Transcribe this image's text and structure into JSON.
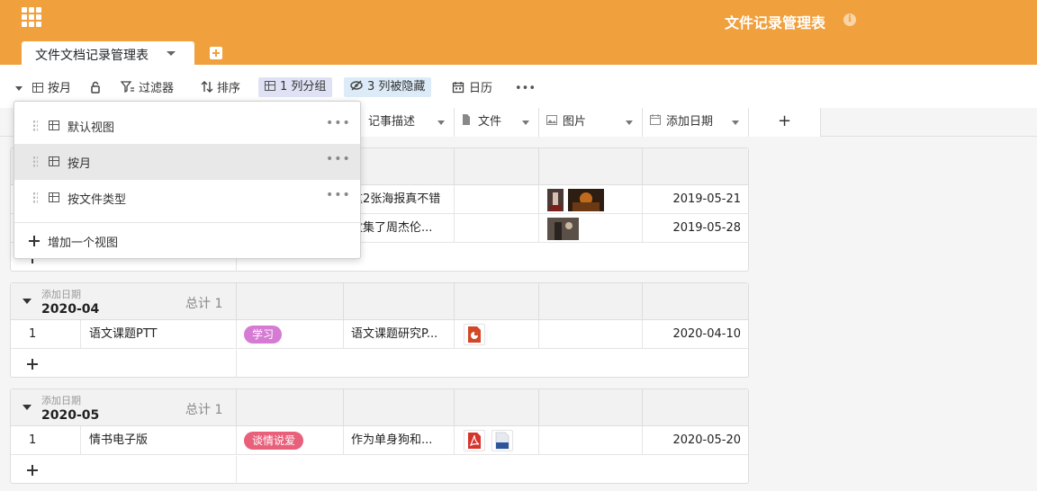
{
  "header": {
    "title": "文件记录管理表",
    "tab_label": "文件文档记录管理表"
  },
  "toolbar": {
    "view_label": "按月",
    "filter_label": "过滤器",
    "sort_label": "排序",
    "group_label": "1 列分组",
    "hidden_label": "3 列被隐藏",
    "calendar_label": "日历",
    "more_label": "•••"
  },
  "columns": [
    {
      "label": "记事描述",
      "icon": "paragraph-icon"
    },
    {
      "label": "文件",
      "icon": "file-icon"
    },
    {
      "label": "图片",
      "icon": "image-icon"
    },
    {
      "label": "添加日期",
      "icon": "calendar-icon"
    }
  ],
  "add_column_label": "+",
  "groups": [
    {
      "field": "",
      "value": "",
      "count": "",
      "rows": [
        {
          "desc": "这2张海报真不错",
          "date": "2019-05-21"
        },
        {
          "desc": "收集了周杰伦...",
          "date": "2019-05-28"
        }
      ]
    },
    {
      "field": "添加日期",
      "value": "2020-04",
      "count": "总计 1",
      "rows": [
        {
          "index": "1",
          "name": "语文课题PTT",
          "tag": "学习",
          "tag_color": "#d67bd4",
          "desc": "语文课题研究P...",
          "date": "2020-04-10"
        }
      ]
    },
    {
      "field": "添加日期",
      "value": "2020-05",
      "count": "总计 1",
      "rows": [
        {
          "index": "1",
          "name": "情书电子版",
          "tag": "谈情说爱",
          "tag_color": "#e8607a",
          "desc": "作为单身狗和...",
          "date": "2020-05-20"
        }
      ]
    }
  ],
  "view_menu": {
    "items": [
      {
        "label": "默认视图",
        "more": "•••"
      },
      {
        "label": "按月",
        "more": "•••",
        "active": true
      },
      {
        "label": "按文件类型",
        "more": "•••"
      }
    ],
    "add_label": "增加一个视图"
  },
  "colors": {
    "header_bg": "#f0a03d",
    "group_badge_bg": "#dfe2f5",
    "hidden_badge_bg": "#dcebf7"
  }
}
